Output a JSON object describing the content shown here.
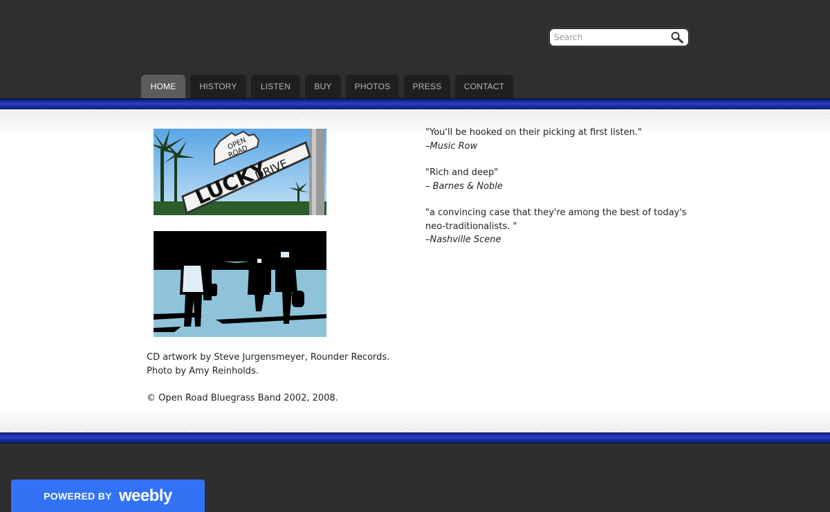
{
  "search": {
    "placeholder": "Search"
  },
  "nav": {
    "tabs": [
      {
        "label": "HOME",
        "active": true
      },
      {
        "label": "HISTORY"
      },
      {
        "label": "LISTEN"
      },
      {
        "label": "BUY"
      },
      {
        "label": "PHOTOS"
      },
      {
        "label": "PRESS"
      },
      {
        "label": "CONTACT"
      }
    ]
  },
  "images": {
    "street_sign": {
      "top_text": "OPEN ROAD",
      "main": "LUCKY",
      "side": "DRIVE"
    }
  },
  "credits": {
    "line1": "CD artwork by Steve Jurgensmeyer, Rounder Records.",
    "line2": "Photo by Amy Reinholds.",
    "copyright": "© Open Road Bluegrass Band 2002, 2008."
  },
  "quotes": [
    {
      "text": "\"You'll be hooked on their picking at first listen.\"",
      "source": "–Music Row"
    },
    {
      "text": "\"Rich and deep\"",
      "source": "– Barnes & Noble"
    },
    {
      "text": "\"a convincing case that they're among the best of today's neo-traditionalists. \"",
      "source": "–Nashville Scene"
    }
  ],
  "footer": {
    "powered_by": "POWERED BY",
    "brand": "weebly"
  },
  "colors": {
    "header_bg": "#2f2f2f",
    "accent_blue": "#1a2ca8",
    "weebly_blue": "#3273f5"
  }
}
